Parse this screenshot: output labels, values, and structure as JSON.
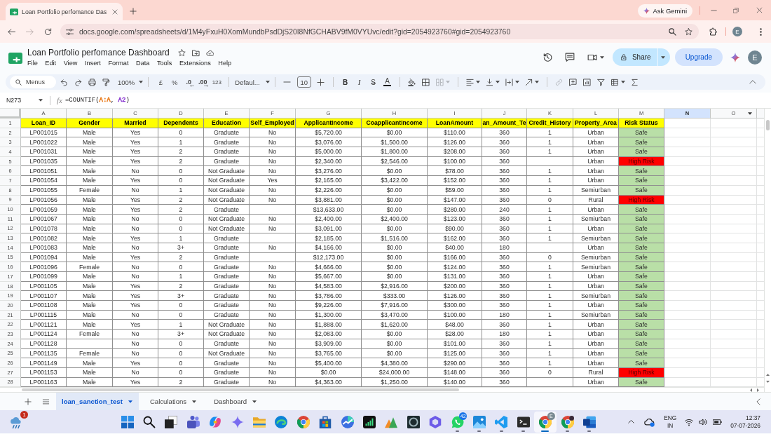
{
  "browser": {
    "tabs": [
      {
        "title": "Loan Portfolio perfomance Das",
        "selected": true
      }
    ],
    "ask_gemini": "Ask Gemini",
    "url": "docs.google.com/spreadsheets/d/1M4yFxuH0XomMundbPsdDjS20I8NfGCHABV9fM0VYUvc/edit?gid=2054923760#gid=2054923760",
    "profile": "E"
  },
  "document": {
    "title": "Loan Portfolio perfomance Dashboard",
    "menus": [
      "File",
      "Edit",
      "View",
      "Insert",
      "Format",
      "Data",
      "Tools",
      "Extensions",
      "Help"
    ],
    "share": "Share",
    "upgrade": "Upgrade",
    "account": "E"
  },
  "toolbar": {
    "search": {
      "placeholder": "Menus"
    },
    "zoom": "100%",
    "currency": "£",
    "percent": "%",
    "fewer_decimals": ".0",
    "more_decimals": ".00",
    "number_format": "123",
    "font": "Defaul...",
    "font_size": "10",
    "bold": "B",
    "italic": "I",
    "strikethrough": "S",
    "text_color": "A"
  },
  "formula_bar": {
    "cell": "N273",
    "function_label": "fx",
    "formula": [
      {
        "text": "=COUNTIF("
      },
      {
        "text": "A:A",
        "color": "#e8710a"
      },
      {
        "text": ", "
      },
      {
        "text": "A2",
        "color": "#8430ce"
      },
      {
        "text": ")"
      }
    ]
  },
  "grid": {
    "columns": [
      {
        "label": "A",
        "selected": false,
        "hovered": false
      },
      {
        "label": "B",
        "selected": false,
        "hovered": false
      },
      {
        "label": "C",
        "selected": false,
        "hovered": false
      },
      {
        "label": "D",
        "selected": false,
        "hovered": false
      },
      {
        "label": "E",
        "selected": false,
        "hovered": false
      },
      {
        "label": "F",
        "selected": false,
        "hovered": false
      },
      {
        "label": "G",
        "selected": false,
        "hovered": false
      },
      {
        "label": "H",
        "selected": false,
        "hovered": false
      },
      {
        "label": "I",
        "selected": false,
        "hovered": false
      },
      {
        "label": "J",
        "selected": false,
        "hovered": false
      },
      {
        "label": "K",
        "selected": false,
        "hovered": false
      },
      {
        "label": "L",
        "selected": false,
        "hovered": false
      },
      {
        "label": "M",
        "selected": false,
        "hovered": false
      },
      {
        "label": "N",
        "selected": true,
        "hovered": false
      },
      {
        "label": "O",
        "selected": false,
        "hovered": true
      }
    ],
    "header_row": {
      "number": "1",
      "cells": [
        "Loan_ID",
        "Gender",
        "Married",
        "Dependents",
        "Education",
        "Self_Employed",
        "ApplicantIncome",
        "CoapplicantIncome",
        "LoanAmount",
        "an_Amount_Te",
        "Credit_History",
        "Property_Area",
        "Risk Status"
      ]
    },
    "rows": [
      {
        "number": "2",
        "high_risk": false,
        "cells": [
          "LP001015",
          "Male",
          "Yes",
          "0",
          "Graduate",
          "No",
          "$5,720.00",
          "$0.00",
          "$110.00",
          "360",
          "1",
          "Urban",
          "Safe"
        ]
      },
      {
        "number": "3",
        "high_risk": false,
        "cells": [
          "LP001022",
          "Male",
          "Yes",
          "1",
          "Graduate",
          "No",
          "$3,076.00",
          "$1,500.00",
          "$126.00",
          "360",
          "1",
          "Urban",
          "Safe"
        ]
      },
      {
        "number": "4",
        "high_risk": false,
        "cells": [
          "LP001031",
          "Male",
          "Yes",
          "2",
          "Graduate",
          "No",
          "$5,000.00",
          "$1,800.00",
          "$208.00",
          "360",
          "1",
          "Urban",
          "Safe"
        ]
      },
      {
        "number": "5",
        "high_risk": true,
        "cells": [
          "LP001035",
          "Male",
          "Yes",
          "2",
          "Graduate",
          "No",
          "$2,340.00",
          "$2,546.00",
          "$100.00",
          "360",
          null,
          "Urban",
          "High Risk"
        ]
      },
      {
        "number": "6",
        "high_risk": false,
        "cells": [
          "LP001051",
          "Male",
          "No",
          "0",
          "Not Graduate",
          "No",
          "$3,276.00",
          "$0.00",
          "$78.00",
          "360",
          "1",
          "Urban",
          "Safe"
        ]
      },
      {
        "number": "7",
        "high_risk": false,
        "cells": [
          "LP001054",
          "Male",
          "Yes",
          "0",
          "Not Graduate",
          "Yes",
          "$2,165.00",
          "$3,422.00",
          "$152.00",
          "360",
          "1",
          "Urban",
          "Safe"
        ]
      },
      {
        "number": "8",
        "high_risk": false,
        "cells": [
          "LP001055",
          "Female",
          "No",
          "1",
          "Not Graduate",
          "No",
          "$2,226.00",
          "$0.00",
          "$59.00",
          "360",
          "1",
          "Semiurban",
          "Safe"
        ]
      },
      {
        "number": "9",
        "high_risk": true,
        "cells": [
          "LP001056",
          "Male",
          "Yes",
          "2",
          "Not Graduate",
          "No",
          "$3,881.00",
          "$0.00",
          "$147.00",
          "360",
          "0",
          "Rural",
          "High Risk"
        ]
      },
      {
        "number": "10",
        "high_risk": false,
        "cells": [
          "LP001059",
          "Male",
          "Yes",
          "2",
          "Graduate",
          null,
          "$13,633.00",
          "$0.00",
          "$280.00",
          "240",
          "1",
          "Urban",
          "Safe"
        ]
      },
      {
        "number": "11",
        "high_risk": false,
        "cells": [
          "LP001067",
          "Male",
          "No",
          "0",
          "Not Graduate",
          "No",
          "$2,400.00",
          "$2,400.00",
          "$123.00",
          "360",
          "1",
          "Semiurban",
          "Safe"
        ]
      },
      {
        "number": "12",
        "high_risk": false,
        "cells": [
          "LP001078",
          "Male",
          "No",
          "0",
          "Not Graduate",
          "No",
          "$3,091.00",
          "$0.00",
          "$90.00",
          "360",
          "1",
          "Urban",
          "Safe"
        ]
      },
      {
        "number": "13",
        "high_risk": false,
        "cells": [
          "LP001082",
          "Male",
          "Yes",
          "1",
          "Graduate",
          null,
          "$2,185.00",
          "$1,516.00",
          "$162.00",
          "360",
          "1",
          "Semiurban",
          "Safe"
        ]
      },
      {
        "number": "14",
        "high_risk": false,
        "cells": [
          "LP001083",
          "Male",
          "No",
          "3+",
          "Graduate",
          "No",
          "$4,166.00",
          "$0.00",
          "$40.00",
          "180",
          null,
          "Urban",
          "Safe"
        ]
      },
      {
        "number": "15",
        "high_risk": false,
        "cells": [
          "LP001094",
          "Male",
          "Yes",
          "2",
          "Graduate",
          null,
          "$12,173.00",
          "$0.00",
          "$166.00",
          "360",
          "0",
          "Semiurban",
          "Safe"
        ]
      },
      {
        "number": "16",
        "high_risk": false,
        "cells": [
          "LP001096",
          "Female",
          "No",
          "0",
          "Graduate",
          "No",
          "$4,666.00",
          "$0.00",
          "$124.00",
          "360",
          "1",
          "Semiurban",
          "Safe"
        ]
      },
      {
        "number": "17",
        "high_risk": false,
        "cells": [
          "LP001099",
          "Male",
          "No",
          "1",
          "Graduate",
          "No",
          "$5,667.00",
          "$0.00",
          "$131.00",
          "360",
          "1",
          "Urban",
          "Safe"
        ]
      },
      {
        "number": "18",
        "high_risk": false,
        "cells": [
          "LP001105",
          "Male",
          "Yes",
          "2",
          "Graduate",
          "No",
          "$4,583.00",
          "$2,916.00",
          "$200.00",
          "360",
          "1",
          "Urban",
          "Safe"
        ]
      },
      {
        "number": "19",
        "high_risk": false,
        "cells": [
          "LP001107",
          "Male",
          "Yes",
          "3+",
          "Graduate",
          "No",
          "$3,786.00",
          "$333.00",
          "$126.00",
          "360",
          "1",
          "Semiurban",
          "Safe"
        ]
      },
      {
        "number": "20",
        "high_risk": false,
        "cells": [
          "LP001108",
          "Male",
          "Yes",
          "0",
          "Graduate",
          "No",
          "$9,226.00",
          "$7,916.00",
          "$300.00",
          "360",
          "1",
          "Urban",
          "Safe"
        ]
      },
      {
        "number": "21",
        "high_risk": false,
        "cells": [
          "LP001115",
          "Male",
          "No",
          "0",
          "Graduate",
          "No",
          "$1,300.00",
          "$3,470.00",
          "$100.00",
          "180",
          "1",
          "Semiurban",
          "Safe"
        ]
      },
      {
        "number": "22",
        "high_risk": false,
        "cells": [
          "LP001121",
          "Male",
          "Yes",
          "1",
          "Not Graduate",
          "No",
          "$1,888.00",
          "$1,620.00",
          "$48.00",
          "360",
          "1",
          "Urban",
          "Safe"
        ]
      },
      {
        "number": "23",
        "high_risk": false,
        "cells": [
          "LP001124",
          "Female",
          "No",
          "3+",
          "Not Graduate",
          "No",
          "$2,083.00",
          "$0.00",
          "$28.00",
          "180",
          "1",
          "Urban",
          "Safe"
        ]
      },
      {
        "number": "24",
        "high_risk": false,
        "cells": [
          "LP001128",
          null,
          "No",
          "0",
          "Graduate",
          "No",
          "$3,909.00",
          "$0.00",
          "$101.00",
          "360",
          "1",
          "Urban",
          "Safe"
        ]
      },
      {
        "number": "25",
        "high_risk": false,
        "cells": [
          "LP001135",
          "Female",
          "No",
          "0",
          "Not Graduate",
          "No",
          "$3,765.00",
          "$0.00",
          "$125.00",
          "360",
          "1",
          "Urban",
          "Safe"
        ]
      },
      {
        "number": "26",
        "high_risk": false,
        "cells": [
          "LP001149",
          "Male",
          "Yes",
          "0",
          "Graduate",
          "No",
          "$5,400.00",
          "$4,380.00",
          "$290.00",
          "360",
          "1",
          "Urban",
          "Safe"
        ]
      },
      {
        "number": "27",
        "high_risk": true,
        "cells": [
          "LP001153",
          "Male",
          "No",
          "0",
          "Graduate",
          "No",
          "$0.00",
          "$24,000.00",
          "$148.00",
          "360",
          "0",
          "Rural",
          "High Risk"
        ]
      },
      {
        "number": "28",
        "high_risk": false,
        "cells": [
          "LP001163",
          "Male",
          "Yes",
          "2",
          "Graduate",
          "No",
          "$4,363.00",
          "$1,250.00",
          "$140.00",
          "360",
          null,
          "Urban",
          "Safe"
        ]
      }
    ]
  },
  "sheet_tabs": [
    {
      "label": "loan_sanction_test",
      "selected": true
    },
    {
      "label": "Calculations",
      "selected": false
    },
    {
      "label": "Dashboard",
      "selected": false
    }
  ],
  "taskbar": {
    "weather_badge": "1",
    "apps": [
      {
        "kind": "start",
        "selected": false,
        "running": false
      },
      {
        "kind": "search",
        "selected": false,
        "running": false
      },
      {
        "kind": "task_view",
        "selected": false,
        "running": false
      },
      {
        "kind": "teams",
        "selected": false,
        "running": false
      },
      {
        "kind": "copilot",
        "selected": false,
        "running": false
      },
      {
        "kind": "sparkle",
        "selected": false,
        "running": false
      },
      {
        "kind": "files",
        "selected": false,
        "running": false
      },
      {
        "kind": "edge",
        "selected": false,
        "running": false
      },
      {
        "kind": "chrome",
        "selected": false,
        "running": false
      },
      {
        "kind": "store",
        "selected": false,
        "running": false
      },
      {
        "kind": "trend",
        "selected": false,
        "running": false
      },
      {
        "kind": "bars",
        "selected": false,
        "running": false
      },
      {
        "kind": "triangle",
        "selected": false,
        "running": false
      },
      {
        "kind": "ring",
        "selected": false,
        "running": false
      },
      {
        "kind": "hexagon",
        "selected": false,
        "running": false
      },
      {
        "kind": "whatsapp",
        "badge": "42",
        "selected": false,
        "running": true
      },
      {
        "kind": "photos",
        "selected": false,
        "running": true
      },
      {
        "kind": "vscode",
        "selected": false,
        "running": true
      },
      {
        "kind": "terminal",
        "selected": false,
        "running": true
      },
      {
        "kind": "chrome",
        "badge": "E",
        "selected": true,
        "running": true
      },
      {
        "kind": "chrome_profile",
        "selected": false,
        "running": true
      },
      {
        "kind": "word",
        "selected": false,
        "running": true
      }
    ],
    "language": "ENG",
    "region": "IN",
    "time": "12:37",
    "date": "07-07-2026"
  }
}
